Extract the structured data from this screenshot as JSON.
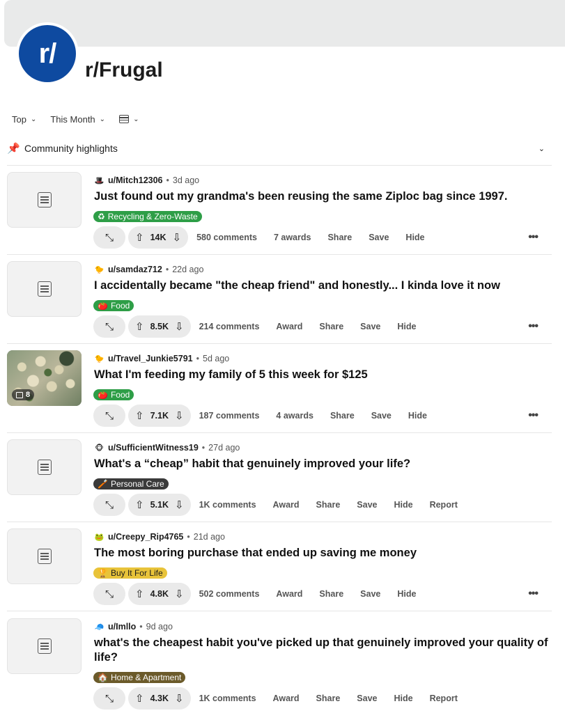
{
  "subreddit": {
    "icon_text": "r/",
    "name": "r/Frugal"
  },
  "sort": {
    "primary": "Top",
    "period": "This Month"
  },
  "highlights": {
    "label": "Community highlights"
  },
  "posts": [
    {
      "author": "u/Mitch12306",
      "age": "3d ago",
      "avatar_glyph": "🎩",
      "title": "Just found out my grandma's been reusing the same Ziploc bag since 1997.",
      "flair": "Recycling & Zero-Waste",
      "flair_icon": "♻",
      "votes": "14K",
      "comments": "580 comments",
      "award": "7 awards",
      "share": "Share",
      "save": "Save",
      "hide": "Hide",
      "report": "",
      "more": "•••"
    },
    {
      "author": "u/samdaz712",
      "age": "22d ago",
      "avatar_glyph": "🐤",
      "title": "I accidentally became \"the cheap friend\" and honestly... I kinda love it now",
      "flair": "Food",
      "flair_icon": "🍅",
      "votes": "8.5K",
      "comments": "214 comments",
      "award": "Award",
      "share": "Share",
      "save": "Save",
      "hide": "Hide",
      "report": "",
      "more": "•••"
    },
    {
      "author": "u/Travel_Junkie5791",
      "age": "5d ago",
      "avatar_glyph": "🐤",
      "title": "What I'm feeding my family of 5 this week for $125",
      "flair": "Food",
      "flair_icon": "🍅",
      "image_count": "8",
      "votes": "7.1K",
      "comments": "187 comments",
      "award": "4 awards",
      "share": "Share",
      "save": "Save",
      "hide": "Hide",
      "report": "",
      "more": "•••"
    },
    {
      "author": "u/SufficientWitness19",
      "age": "27d ago",
      "avatar_glyph": "🐵",
      "title": "What's a “cheap” habit that genuinely improved your life?",
      "flair": "Personal Care",
      "flair_icon": "🪥",
      "votes": "5.1K",
      "comments": "1K comments",
      "award": "Award",
      "share": "Share",
      "save": "Save",
      "hide": "Hide",
      "report": "Report",
      "more": ""
    },
    {
      "author": "u/Creepy_Rip4765",
      "age": "21d ago",
      "avatar_glyph": "🐸",
      "title": "The most boring purchase that ended up saving me money",
      "flair": "Buy It For Life",
      "flair_icon": "🏆",
      "votes": "4.8K",
      "comments": "502 comments",
      "award": "Award",
      "share": "Share",
      "save": "Save",
      "hide": "Hide",
      "report": "",
      "more": "•••"
    },
    {
      "author": "u/Imllo",
      "age": "9d ago",
      "avatar_glyph": "🧢",
      "title": "what's the cheapest habit you've picked up that genuinely improved your quality of life?",
      "flair": "Home & Apartment",
      "flair_icon": "🏠",
      "votes": "4.3K",
      "comments": "1K comments",
      "award": "Award",
      "share": "Share",
      "save": "Save",
      "hide": "Hide",
      "report": "Report",
      "more": ""
    }
  ],
  "colors": {
    "subreddit_icon": "#0e4aa0",
    "flair_recycling": "#2e9e47",
    "flair_food": "#2e9e47",
    "flair_personal_care": "#3a3a3a",
    "flair_buy_it_for_life": "#e8c33a",
    "flair_home": "#6b5a2a"
  }
}
